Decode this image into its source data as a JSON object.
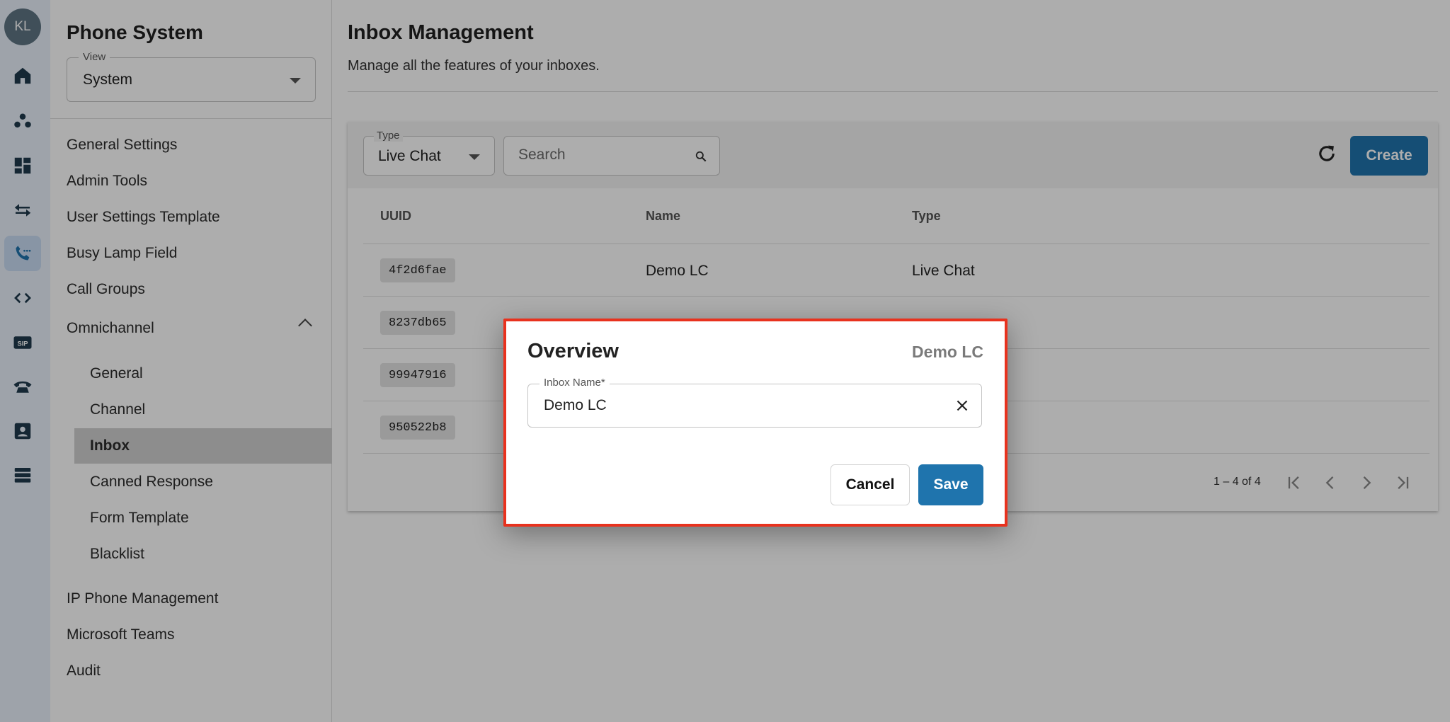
{
  "user": {
    "initials": "KL"
  },
  "rail": {
    "icons": [
      "home-icon",
      "groups-icon",
      "dashboard-icon",
      "swap-arrows-icon",
      "phone-call-icon",
      "code-icon",
      "sip-icon",
      "telephone-icon",
      "contact-card-icon",
      "storage-icon"
    ],
    "active": "phone-call-icon",
    "sip_label": "SIP"
  },
  "sidebar": {
    "title": "Phone System",
    "view": {
      "label": "View",
      "value": "System"
    },
    "items": [
      {
        "label": "General Settings"
      },
      {
        "label": "Admin Tools"
      },
      {
        "label": "User Settings Template"
      },
      {
        "label": "Busy Lamp Field"
      },
      {
        "label": "Call Groups"
      },
      {
        "label": "Omnichannel"
      }
    ],
    "subitems": [
      {
        "label": "General"
      },
      {
        "label": "Channel"
      },
      {
        "label": "Inbox"
      },
      {
        "label": "Canned Response"
      },
      {
        "label": "Form Template"
      },
      {
        "label": "Blacklist"
      }
    ],
    "active_subitem": "Inbox",
    "bottom_items": [
      {
        "label": "IP Phone Management"
      },
      {
        "label": "Microsoft Teams"
      },
      {
        "label": "Audit"
      }
    ]
  },
  "main": {
    "title": "Inbox Management",
    "subtitle": "Manage all the features of your inboxes.",
    "filter": {
      "label": "Type",
      "value": "Live Chat"
    },
    "search": {
      "placeholder": "Search"
    },
    "create_label": "Create",
    "table": {
      "headers": [
        "UUID",
        "Name",
        "Type"
      ],
      "rows": [
        {
          "uuid": "4f2d6fae",
          "name": "Demo LC",
          "type": "Live Chat"
        },
        {
          "uuid": "8237db65",
          "name": "",
          "type": ""
        },
        {
          "uuid": "99947916",
          "name": "",
          "type": ""
        },
        {
          "uuid": "950522b8",
          "name": "",
          "type": ""
        }
      ]
    },
    "pagination": "1 – 4 of 4"
  },
  "dialog": {
    "title": "Overview",
    "name": "Demo LC",
    "field_label": "Inbox Name*",
    "field_value": "Demo LC",
    "cancel_label": "Cancel",
    "save_label": "Save",
    "highlight_color": "#e8321e"
  },
  "colors": {
    "primary": "#1f74ad",
    "rail_bg": "#e9f1fb",
    "rail_active": "#c9dcf3"
  }
}
